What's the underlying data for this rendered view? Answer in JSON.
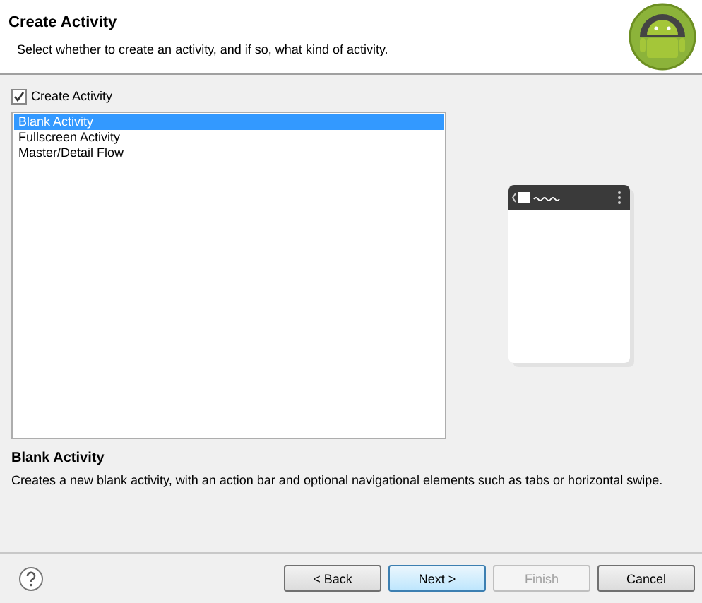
{
  "header": {
    "title": "Create Activity",
    "subtitle": "Select whether to create an activity, and if so, what kind of activity."
  },
  "create_checkbox": {
    "label": "Create Activity",
    "checked": true
  },
  "templates": [
    {
      "label": "Blank Activity",
      "selected": true
    },
    {
      "label": "Fullscreen Activity",
      "selected": false
    },
    {
      "label": "Master/Detail Flow",
      "selected": false
    }
  ],
  "description": {
    "title": "Blank Activity",
    "text": "Creates a new blank activity, with an action bar and optional navigational elements such as tabs or horizontal swipe."
  },
  "buttons": [
    {
      "label": "< Back",
      "disabled": false,
      "focused": false
    },
    {
      "label": "Next >",
      "disabled": false,
      "focused": true
    },
    {
      "label": "Finish",
      "disabled": true,
      "focused": false
    },
    {
      "label": "Cancel",
      "disabled": false,
      "focused": false
    }
  ]
}
